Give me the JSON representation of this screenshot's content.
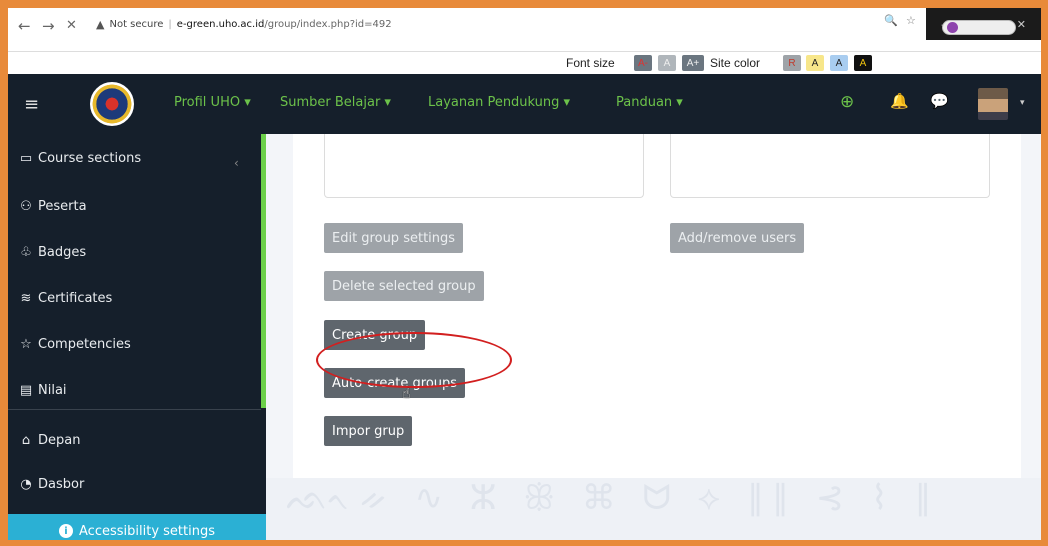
{
  "browser": {
    "back": "←",
    "forward": "→",
    "close": "✕",
    "security": "Not secure",
    "url_host": "e-green.uho.ac.id",
    "url_path": "/group/index.php?id=492",
    "zoom_icon": "🔍",
    "star_icon": "☆",
    "win_minimize": "–",
    "win_maximize": "□",
    "win_close": "✕"
  },
  "accessibility_bar": {
    "font_size_label": "Font size",
    "font_chips": [
      "A-",
      "A",
      "A+"
    ],
    "site_color_label": "Site color",
    "color_chips": [
      {
        "label": "R",
        "bg": "#9ea3a8",
        "fg": "#c0392b"
      },
      {
        "label": "A",
        "bg": "#f7e68a",
        "fg": "#222222"
      },
      {
        "label": "A",
        "bg": "#a9cdf0",
        "fg": "#222222"
      },
      {
        "label": "A",
        "bg": "#111111",
        "fg": "#f1c40f"
      }
    ]
  },
  "header": {
    "menu_icon": "≡",
    "nav": [
      "Profil UHO ▾",
      "Sumber Belajar ▾",
      "Layanan Pendukung ▾",
      "Panduan ▾"
    ],
    "globe_icon": "⊕",
    "bell_icon": "🔔",
    "chat_icon": "💬",
    "caret": "▾",
    "accent_color": "#6cc24a"
  },
  "sidebar": {
    "items": [
      {
        "icon": "▭",
        "label": "Course sections"
      },
      {
        "icon": "⚇",
        "label": "Peserta"
      },
      {
        "icon": "♧",
        "label": "Badges"
      },
      {
        "icon": "≋",
        "label": "Certificates"
      },
      {
        "icon": "☆",
        "label": "Competencies"
      },
      {
        "icon": "▤",
        "label": "Nilai"
      },
      {
        "icon": "⌂",
        "label": "Depan"
      },
      {
        "icon": "◔",
        "label": "Dasbor"
      }
    ],
    "collapse_icon": "‹",
    "accessibility_button": "Accessibility settings"
  },
  "main": {
    "buttons": {
      "edit_group_settings": "Edit group settings",
      "add_remove_users": "Add/remove users",
      "delete_selected_group": "Delete selected group",
      "create_group": "Create group",
      "auto_create_groups": "Auto-create groups",
      "impor_grup": "Impor grup"
    },
    "highlight_color": "#d21f1f"
  },
  "watermark_text": "ᨒᨚᨀ ∿ ⵣ ꕥ ⌘ ᗢ ⟡ ∥∥ ⊰ ⌇ ∥"
}
